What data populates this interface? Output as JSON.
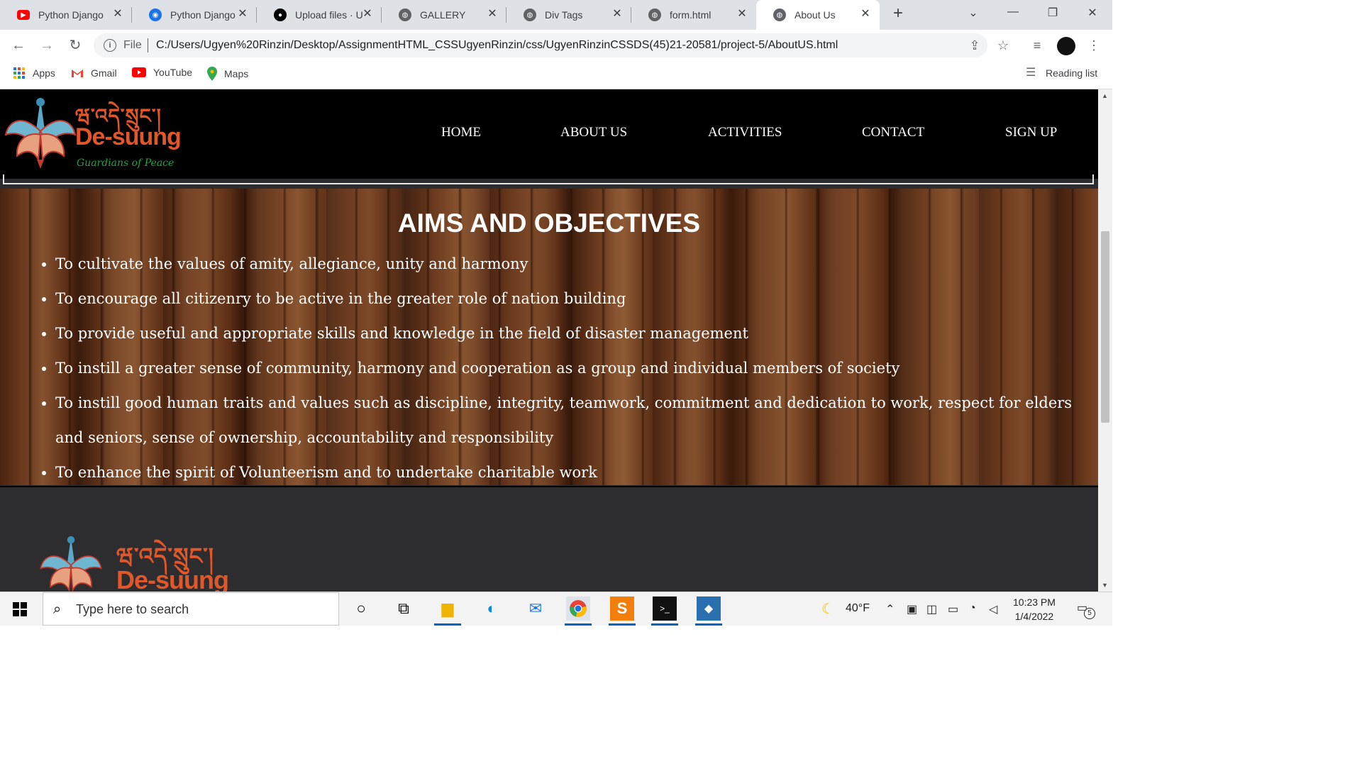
{
  "browser": {
    "tabs": [
      {
        "title": "Python Django",
        "icon": "youtube-icon",
        "color": "#ff0000"
      },
      {
        "title": "Python Django",
        "icon": "radio-icon",
        "color": "#1a73e8"
      },
      {
        "title": "Upload files · U",
        "icon": "github-icon",
        "color": "#000000"
      },
      {
        "title": "GALLERY",
        "icon": "globe-icon",
        "color": "#5f6368"
      },
      {
        "title": "Div Tags",
        "icon": "globe-icon",
        "color": "#5f6368"
      },
      {
        "title": "form.html",
        "icon": "globe-icon",
        "color": "#5f6368"
      },
      {
        "title": "About Us",
        "icon": "globe-icon",
        "color": "#5f6368",
        "active": true
      }
    ],
    "address": {
      "scheme_label": "File",
      "url": "C:/Users/Ugyen%20Rinzin/Desktop/AssignmentHTML_CSSUgyenRinzin/css/UgyenRinzinCSSDS(45)21-20581/project-5/AboutUS.html"
    },
    "bookmarks": [
      {
        "label": "Apps",
        "icon": "apps-grid-icon"
      },
      {
        "label": "Gmail",
        "icon": "gmail-icon"
      },
      {
        "label": "YouTube",
        "icon": "youtube-icon"
      },
      {
        "label": "Maps",
        "icon": "maps-pin-icon"
      }
    ],
    "reading_list": "Reading list"
  },
  "site": {
    "logo": {
      "tibetan": "ཝ་འདེ་སྲུང་།",
      "name": "De-suung",
      "tagline": "Guardians of Peace"
    },
    "nav": [
      "HOME",
      "ABOUT US",
      "ACTIVITIES",
      "CONTACT",
      "SIGN UP"
    ],
    "section_title": "AIMS AND OBJECTIVES",
    "objectives": [
      "To cultivate the values of amity, allegiance, unity and harmony",
      "To encourage all citizenry to be active in the greater role of nation building",
      "To provide useful and appropriate skills and knowledge in the field of disaster management",
      "To instill a greater sense of community, harmony and cooperation as a group and individual members of society",
      "To instill good human traits and values such as discipline, integrity, teamwork, commitment and dedication to work, respect for elders and seniors, sense of ownership, accountability and responsibility",
      "To enhance the spirit of Volunteerism and to undertake charitable work"
    ]
  },
  "taskbar": {
    "search_placeholder": "Type here to search",
    "weather": "40°F",
    "time": "10:23 PM",
    "date": "1/4/2022",
    "notifications": "5"
  },
  "colors": {
    "accent": "#e2572a",
    "tagline": "#1fa34a",
    "header_bg": "#000000",
    "footer_bg": "#2d2d2f"
  }
}
